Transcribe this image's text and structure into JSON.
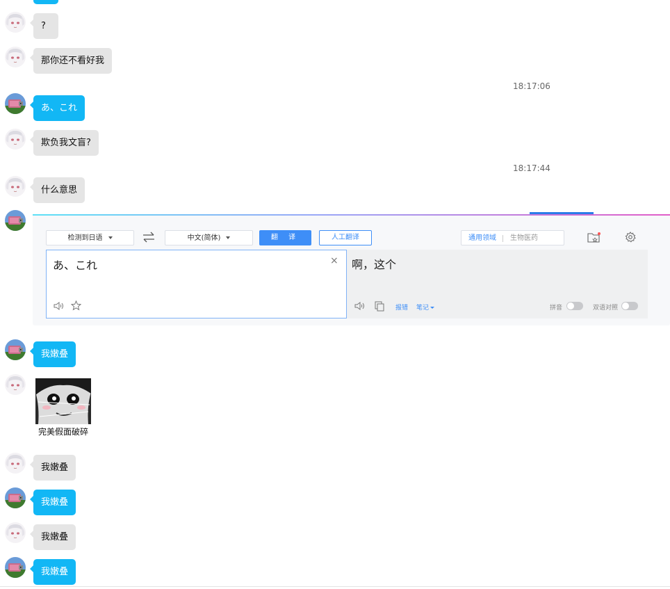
{
  "messages": [
    {
      "side": "other",
      "text": "?"
    },
    {
      "side": "other",
      "text": "那你还不看好我"
    },
    {
      "time": "18:17:06"
    },
    {
      "side": "me",
      "text": "あ、これ"
    },
    {
      "side": "other",
      "text": "欺负我文盲?"
    },
    {
      "time": "18:17:44"
    },
    {
      "side": "other",
      "text": "什么意思"
    },
    {
      "side": "me",
      "text": "我嫩叠"
    },
    {
      "side": "other",
      "sticker_caption": "完美假面破碎"
    },
    {
      "side": "other",
      "text": "我嫩叠"
    },
    {
      "side": "me",
      "text": "我嫩叠"
    },
    {
      "side": "other",
      "text": "我嫩叠"
    },
    {
      "side": "me",
      "text": "我嫩叠"
    }
  ],
  "translator": {
    "source_lang": "检测到日语",
    "target_lang": "中文(简体)",
    "translate_button": "翻 译",
    "human_translate_button": "人工翻译",
    "domain_general": "通用领域",
    "domain_bio": "生物医药",
    "source_text": "あ、これ",
    "result_text": "啊，这个",
    "report_link": "报错",
    "notes_link": "笔记",
    "pinyin_label": "拼音",
    "bilingual_label": "双语对照"
  },
  "icons": {
    "swap": "swap-arrows-icon",
    "favorites": "favorites-folder-icon",
    "settings": "gear-icon",
    "clear": "close-icon",
    "speaker": "speaker-icon",
    "star": "star-icon",
    "copy": "copy-icon"
  },
  "colors": {
    "my_bubble": "#12b7f5",
    "other_bubble": "#e5e5e5",
    "accent": "#3e8ef7"
  }
}
